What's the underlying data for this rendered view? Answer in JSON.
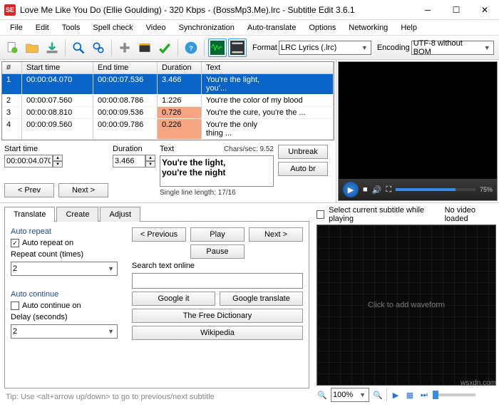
{
  "window": {
    "title": "Love Me Like You Do (Ellie Goulding) - 320 Kbps - (BossMp3.Me).lrc - Subtitle Edit 3.6.1",
    "app_badge": "SE"
  },
  "menu": [
    "File",
    "Edit",
    "Tools",
    "Spell check",
    "Video",
    "Synchronization",
    "Auto-translate",
    "Options",
    "Networking",
    "Help"
  ],
  "toolbar": {
    "format_label": "Format",
    "format_value": "LRC Lyrics (.lrc)",
    "encoding_label": "Encoding",
    "encoding_value": "UTF-8 without BOM"
  },
  "grid": {
    "headers": {
      "num": "#",
      "start": "Start time",
      "end": "End time",
      "dur": "Duration",
      "text": "Text"
    },
    "rows": [
      {
        "n": "1",
        "st": "00:00:04.070",
        "et": "00:00:07.536",
        "dur": "3.466",
        "txt": "You're the light,<br />you'...",
        "sel": true
      },
      {
        "n": "2",
        "st": "00:00:07.560",
        "et": "00:00:08.786",
        "dur": "1.226",
        "txt": "You're the color of my blood"
      },
      {
        "n": "3",
        "st": "00:00:08.810",
        "et": "00:00:09.536",
        "dur": "0.726",
        "txt": "You're the cure, you're the ...",
        "warn": true
      },
      {
        "n": "4",
        "st": "00:00:09.560",
        "et": "00:00:09.786",
        "dur": "0.226",
        "txt": "You're the only<br />thing ...",
        "warn": true
      }
    ]
  },
  "edit": {
    "start_label": "Start time",
    "start_value": "00:00:04.070",
    "dur_label": "Duration",
    "dur_value": "3.466",
    "text_label": "Text",
    "chars_label": "Chars/sec: 9.52",
    "text_value": "You're the light,\nyou're the night",
    "line_len": "Single line length: 17/16",
    "unbreak": "Unbreak",
    "autobr": "Auto br",
    "prev": "< Prev",
    "next": "Next >"
  },
  "tabs": {
    "translate": "Translate",
    "create": "Create",
    "adjust": "Adjust"
  },
  "translate": {
    "auto_repeat": "Auto repeat",
    "auto_repeat_on": "Auto repeat on",
    "repeat_count": "Repeat count (times)",
    "repeat_value": "2",
    "auto_continue": "Auto continue",
    "auto_continue_on": "Auto continue on",
    "delay": "Delay (seconds)",
    "delay_value": "2",
    "previous": "< Previous",
    "play": "Play",
    "next": "Next >",
    "pause": "Pause",
    "search_label": "Search text online",
    "google": "Google it",
    "gtranslate": "Google translate",
    "free_dict": "The Free Dictionary",
    "wikipedia": "Wikipedia",
    "tip": "Tip: Use <alt+arrow up/down> to go to previous/next subtitle"
  },
  "wave": {
    "select_playing": "Select current subtitle while playing",
    "no_video": "No video loaded",
    "click_add": "Click to add waveform",
    "zoom": "100%"
  },
  "video": {
    "pct": "75%"
  },
  "watermark": "wsxdn.com"
}
